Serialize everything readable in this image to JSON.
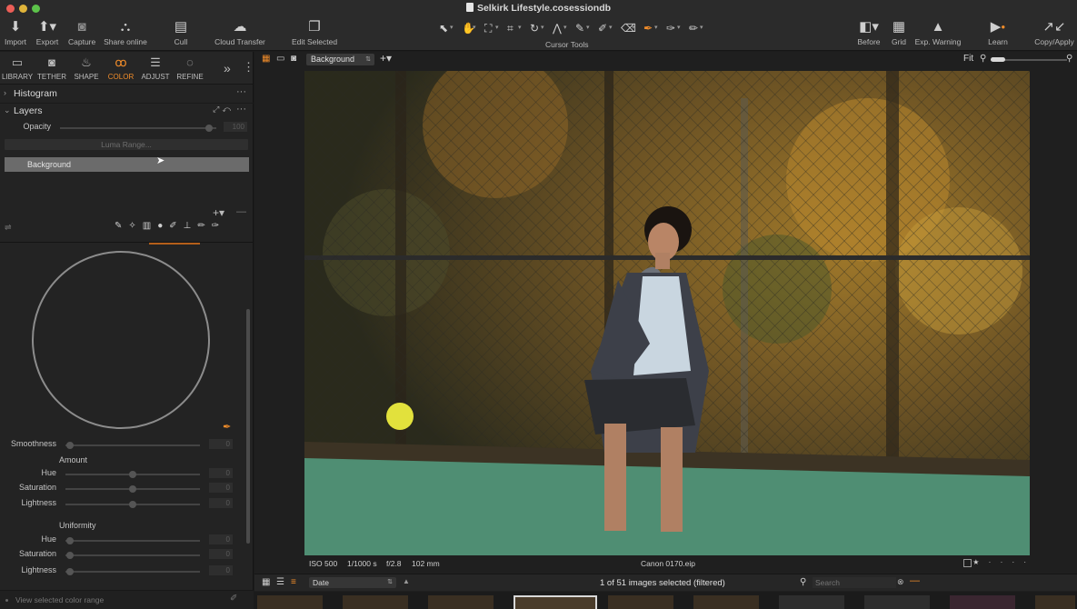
{
  "window": {
    "title": "Selkirk Lifestyle.cosessiondb"
  },
  "toolbar": {
    "left": [
      {
        "label": "Import",
        "icon": "import-icon"
      },
      {
        "label": "Export",
        "icon": "export-icon"
      },
      {
        "label": "Capture",
        "icon": "camera-icon"
      },
      {
        "label": "Share online",
        "icon": "share-icon"
      },
      {
        "label": "Cull",
        "icon": "cull-icon"
      },
      {
        "label": "Cloud Transfer",
        "icon": "cloud-icon"
      },
      {
        "label": "Edit Selected",
        "icon": "layers-icon"
      }
    ],
    "cursor_tools_label": "Cursor Tools",
    "right": [
      {
        "label": "Before",
        "icon": "before-icon"
      },
      {
        "label": "Grid",
        "icon": "grid-icon"
      },
      {
        "label": "Exp. Warning",
        "icon": "warning-icon"
      },
      {
        "label": "Learn",
        "icon": "learn-icon"
      },
      {
        "label": "Copy/Apply",
        "icon": "copy-apply-icon"
      }
    ]
  },
  "tool_tabs": [
    {
      "label": "LIBRARY",
      "icon": "folder-icon",
      "active": false
    },
    {
      "label": "TETHER",
      "icon": "camera-icon",
      "active": false
    },
    {
      "label": "SHAPE",
      "icon": "shape-icon",
      "active": false
    },
    {
      "label": "COLOR",
      "icon": "color-circles-icon",
      "active": true
    },
    {
      "label": "ADJUST",
      "icon": "sliders-icon",
      "active": false
    },
    {
      "label": "REFINE",
      "icon": "refine-icon",
      "active": false
    }
  ],
  "panels": {
    "histogram": {
      "title": "Histogram"
    },
    "layers": {
      "title": "Layers",
      "opacity_label": "Opacity",
      "opacity_value": "100",
      "luma_range_label": "Luma Range...",
      "layer_items": [
        "Background"
      ]
    },
    "color_editor": {
      "smoothness_label": "Smoothness",
      "smoothness_value": "0",
      "amount_label": "Amount",
      "amount": [
        {
          "label": "Hue",
          "value": "0"
        },
        {
          "label": "Saturation",
          "value": "0"
        },
        {
          "label": "Lightness",
          "value": "0"
        }
      ],
      "uniformity_label": "Uniformity",
      "uniformity": [
        {
          "label": "Hue",
          "value": "0"
        },
        {
          "label": "Saturation",
          "value": "0"
        },
        {
          "label": "Lightness",
          "value": "0"
        }
      ],
      "view_range_label": "View selected color range"
    }
  },
  "viewer": {
    "layer_select": "Background",
    "zoom_label": "Fit",
    "info": {
      "iso": "ISO 500",
      "shutter": "1/1000 s",
      "aperture": "f/2.8",
      "focal": "102 mm",
      "filename": "Canon 0170.eip"
    },
    "rating_glyphs": "★ · · · ·"
  },
  "browser": {
    "sort_by": "Date",
    "selection_status": "1 of 51 images selected (filtered)",
    "search_placeholder": "Search"
  },
  "colors": {
    "accent": "#f08c2a",
    "panel_bg": "#232323",
    "toolbar_bg": "#2b2b2b",
    "selected_layer": "#6b6b6b"
  }
}
